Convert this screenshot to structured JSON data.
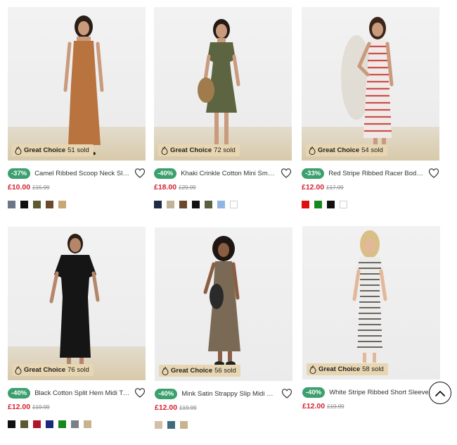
{
  "products": [
    {
      "badge_label": "Great Choice",
      "sold": "51 sold",
      "discount": "-37%",
      "name": "Camel Ribbed Scoop Neck Sleeveless Maxi Dress",
      "price": "£10.00",
      "was_price": "£15.99",
      "swatches": [
        "#6b7788",
        "#111111",
        "#5b5a33",
        "#6b4a2b",
        "#c9a676"
      ]
    },
    {
      "badge_label": "Great Choice",
      "sold": "72 sold",
      "discount": "-40%",
      "name": "Khaki Crinkle Cotton Mini Smock Dress",
      "price": "£18.00",
      "was_price": "£29.99",
      "swatches": [
        "#1f2a44",
        "#c2b398",
        "#6b4a2b",
        "#111111",
        "#5b6140",
        "#8fb6e0",
        "#ffffff"
      ]
    },
    {
      "badge_label": "Great Choice",
      "sold": "54 sold",
      "discount": "-33%",
      "name": "Red Stripe Ribbed Racer Bodycon Midi Dress",
      "price": "£12.00",
      "was_price": "£17.99",
      "swatches": [
        "#e01010",
        "#16871f",
        "#111111",
        "#ffffff"
      ]
    },
    {
      "badge_label": "Great Choice",
      "sold": "76 sold",
      "discount": "-40%",
      "name": "Black Cotton Split Hem Midi T-Shirt Dress",
      "price": "£12.00",
      "was_price": "£19.99",
      "swatches": [
        "#111111",
        "#5b5a33",
        "#b0142a",
        "#1a2a7a",
        "#16871f",
        "#7b8088",
        "#c9b38e"
      ]
    },
    {
      "badge_label": "Great Choice",
      "sold": "56 sold",
      "discount": "-40%",
      "name": "Mink Satin Strappy Slip Midi Dress",
      "price": "£12.00",
      "was_price": "£19.99",
      "swatches": [
        "#d3bfa9",
        "#3f6c7a",
        "#c9b38e"
      ]
    },
    {
      "badge_label": "Great Choice",
      "sold": "58 sold",
      "discount": "-40%",
      "name": "White Stripe Ribbed Short Sleeve Midi Dress",
      "price": "£12.00",
      "was_price": "£19.99",
      "swatches": []
    }
  ],
  "colors": {
    "discount_bg": "#3ba06e",
    "price_red": "#d6212f",
    "badge_bg": "#e7d6b1"
  }
}
